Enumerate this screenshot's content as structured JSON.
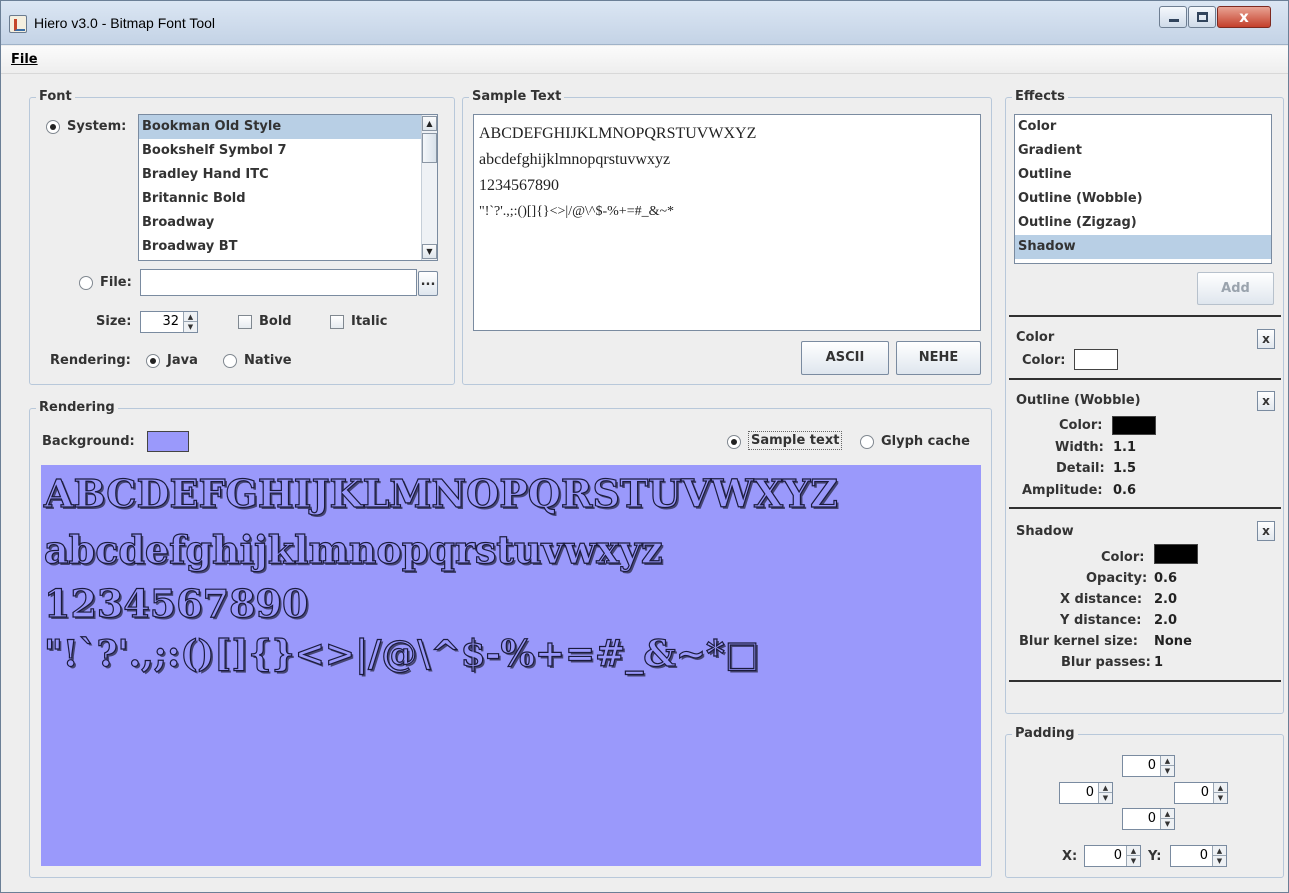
{
  "window": {
    "title": "Hiero v3.0 - Bitmap Font Tool",
    "close_glyph": "x"
  },
  "menu": {
    "file": "File"
  },
  "font_panel": {
    "title": "Font",
    "system_label": "System:",
    "file_label": "File:",
    "browse_label": "...",
    "fonts": [
      "Bookman Old Style",
      "Bookshelf Symbol 7",
      "Bradley Hand ITC",
      "Britannic Bold",
      "Broadway",
      "Broadway BT"
    ],
    "selected_font": "Bookman Old Style",
    "size_label": "Size:",
    "size_value": "32",
    "bold_label": "Bold",
    "italic_label": "Italic",
    "rendering_label": "Rendering:",
    "java_label": "Java",
    "native_label": "Native"
  },
  "sample_panel": {
    "title": "Sample Text",
    "lines": [
      "ABCDEFGHIJKLMNOPQRSTUVWXYZ",
      "abcdefghijklmnopqrstuvwxyz",
      "1234567890",
      "\"!`?'.,;:()[]{}<>|/@\\^$-%+=#_&~*"
    ],
    "ascii_label": "ASCII",
    "nehe_label": "NEHE"
  },
  "rendering_panel": {
    "title": "Rendering",
    "background_label": "Background:",
    "background_color": "#9a99fb",
    "sample_text_label": "Sample text",
    "glyph_cache_label": "Glyph cache",
    "preview_lines": [
      "ABCDEFGHIJKLMNOPQRSTUVWXYZ",
      "abcdefghijklmnopqrstuvwxyz",
      "1234567890",
      "\"!`?'.,;:()[]{}<>|/@\\^$-%+=#_&~*□"
    ]
  },
  "effects_panel": {
    "title": "Effects",
    "effects": [
      "Color",
      "Gradient",
      "Outline",
      "Outline (Wobble)",
      "Outline (Zigzag)",
      "Shadow"
    ],
    "selected_effect": "Shadow",
    "add_label": "Add",
    "color_effect": {
      "title": "Color",
      "color_label": "Color:",
      "color_value": "#ffffff"
    },
    "wobble_effect": {
      "title": "Outline (Wobble)",
      "color_label": "Color:",
      "color_value": "#000000",
      "width_label": "Width:",
      "width_value": "1.1",
      "detail_label": "Detail:",
      "detail_value": "1.5",
      "amplitude_label": "Amplitude:",
      "amplitude_value": "0.6"
    },
    "shadow_effect": {
      "title": "Shadow",
      "color_label": "Color:",
      "color_value": "#000000",
      "opacity_label": "Opacity:",
      "opacity_value": "0.6",
      "xdist_label": "X distance:",
      "xdist_value": "2.0",
      "ydist_label": "Y distance:",
      "ydist_value": "2.0",
      "blur_kernel_label": "Blur kernel size:",
      "blur_kernel_value": "None",
      "blur_passes_label": "Blur passes:",
      "blur_passes_value": "1"
    }
  },
  "padding_panel": {
    "title": "Padding",
    "top": "0",
    "left": "0",
    "right": "0",
    "bottom": "0",
    "x_label": "X:",
    "x_value": "0",
    "y_label": "Y:",
    "y_value": "0"
  }
}
